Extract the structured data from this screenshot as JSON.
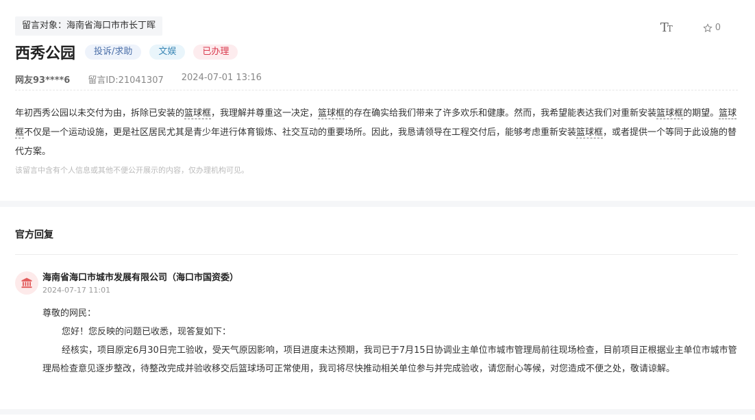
{
  "message": {
    "recipient": "留言对象：海南省海口市市长丁晖",
    "font_size_icon": "text-size-icon",
    "favorite_count": "0",
    "title": "西秀公园",
    "tags": [
      "投诉/求助",
      "文娱",
      "已办理"
    ],
    "user": "网友93****6",
    "message_id": "留言ID:21041307",
    "datetime": "2024-07-01 13:16",
    "body_parts": [
      "年初西秀公园以未交付为由，拆除已安装的",
      "篮球框",
      "，我理解并尊重这一决定，",
      "篮球框",
      "的存在确实给我们带来了许多欢乐和健康。然而，我希望能表达我们对重新安装",
      "篮球框",
      "的期望。",
      "篮球框",
      "不仅是一个运动设施，更是社区居民尤其是青少年进行体育锻炼、社交互动的重要场所。因此，我恳请领导在工程交付后，能够考虑重新安装",
      "篮球框",
      "，或者提供一个等同于此设施的替代方案。"
    ],
    "privacy_notice": "该留言中含有个人信息或其他不便公开展示的内容，仅办理机构可见。"
  },
  "reply": {
    "heading": "官方回复",
    "organization": "海南省海口市城市发展有限公司（海口市国资委）",
    "date": "2024-07-17 11:01",
    "salutation": "尊敬的网民：",
    "para1": "您好！您反映的问题已收悉，现答复如下：",
    "para2": "经核实，项目原定6月30日完工验收，受天气原因影响，项目进度未达预期，我司已于7月15日协调业主单位市城市管理局前往现场检查，目前项目正根据业主单位市城市管理局检查意见逐步整改，待整改完成并验收移交后篮球场可正常使用，我司将尽快推动相关单位参与并完成验收，请您耐心等候，对您造成不便之处，敬请谅解。"
  },
  "colors": {
    "tag_blue": "#4b6fa8",
    "tag_red": "#d9394d",
    "avatar_bg": "#fdeaea",
    "avatar_icon": "#e25b5b"
  }
}
